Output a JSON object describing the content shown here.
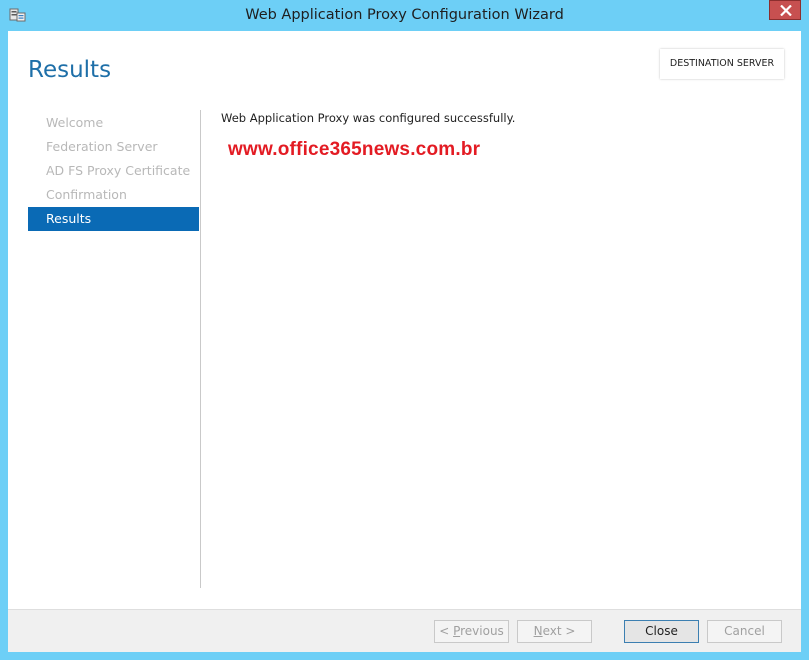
{
  "window": {
    "title": "Web Application Proxy Configuration Wizard"
  },
  "header": {
    "page_title": "Results",
    "destination_label": "DESTINATION SERVER"
  },
  "nav": {
    "items": [
      {
        "label": "Welcome",
        "active": false
      },
      {
        "label": "Federation Server",
        "active": false
      },
      {
        "label": "AD FS Proxy Certificate",
        "active": false
      },
      {
        "label": "Confirmation",
        "active": false
      },
      {
        "label": "Results",
        "active": true
      }
    ]
  },
  "main": {
    "message": "Web Application Proxy was configured successfully.",
    "watermark": "www.office365news.com.br"
  },
  "footer": {
    "previous_mnemonic": "P",
    "previous_rest": "revious",
    "previous_prefix": "< ",
    "next_mnemonic": "N",
    "next_rest": "ext >",
    "close_label": "Close",
    "cancel_label": "Cancel"
  },
  "colors": {
    "frame": "#6dcff6",
    "accent": "#0a6ab5",
    "title_blue": "#1e6fa8",
    "watermark_red": "#e31b23",
    "close_red": "#c75050"
  },
  "icons": {
    "app": "server-wizard-icon",
    "close": "close-icon"
  }
}
